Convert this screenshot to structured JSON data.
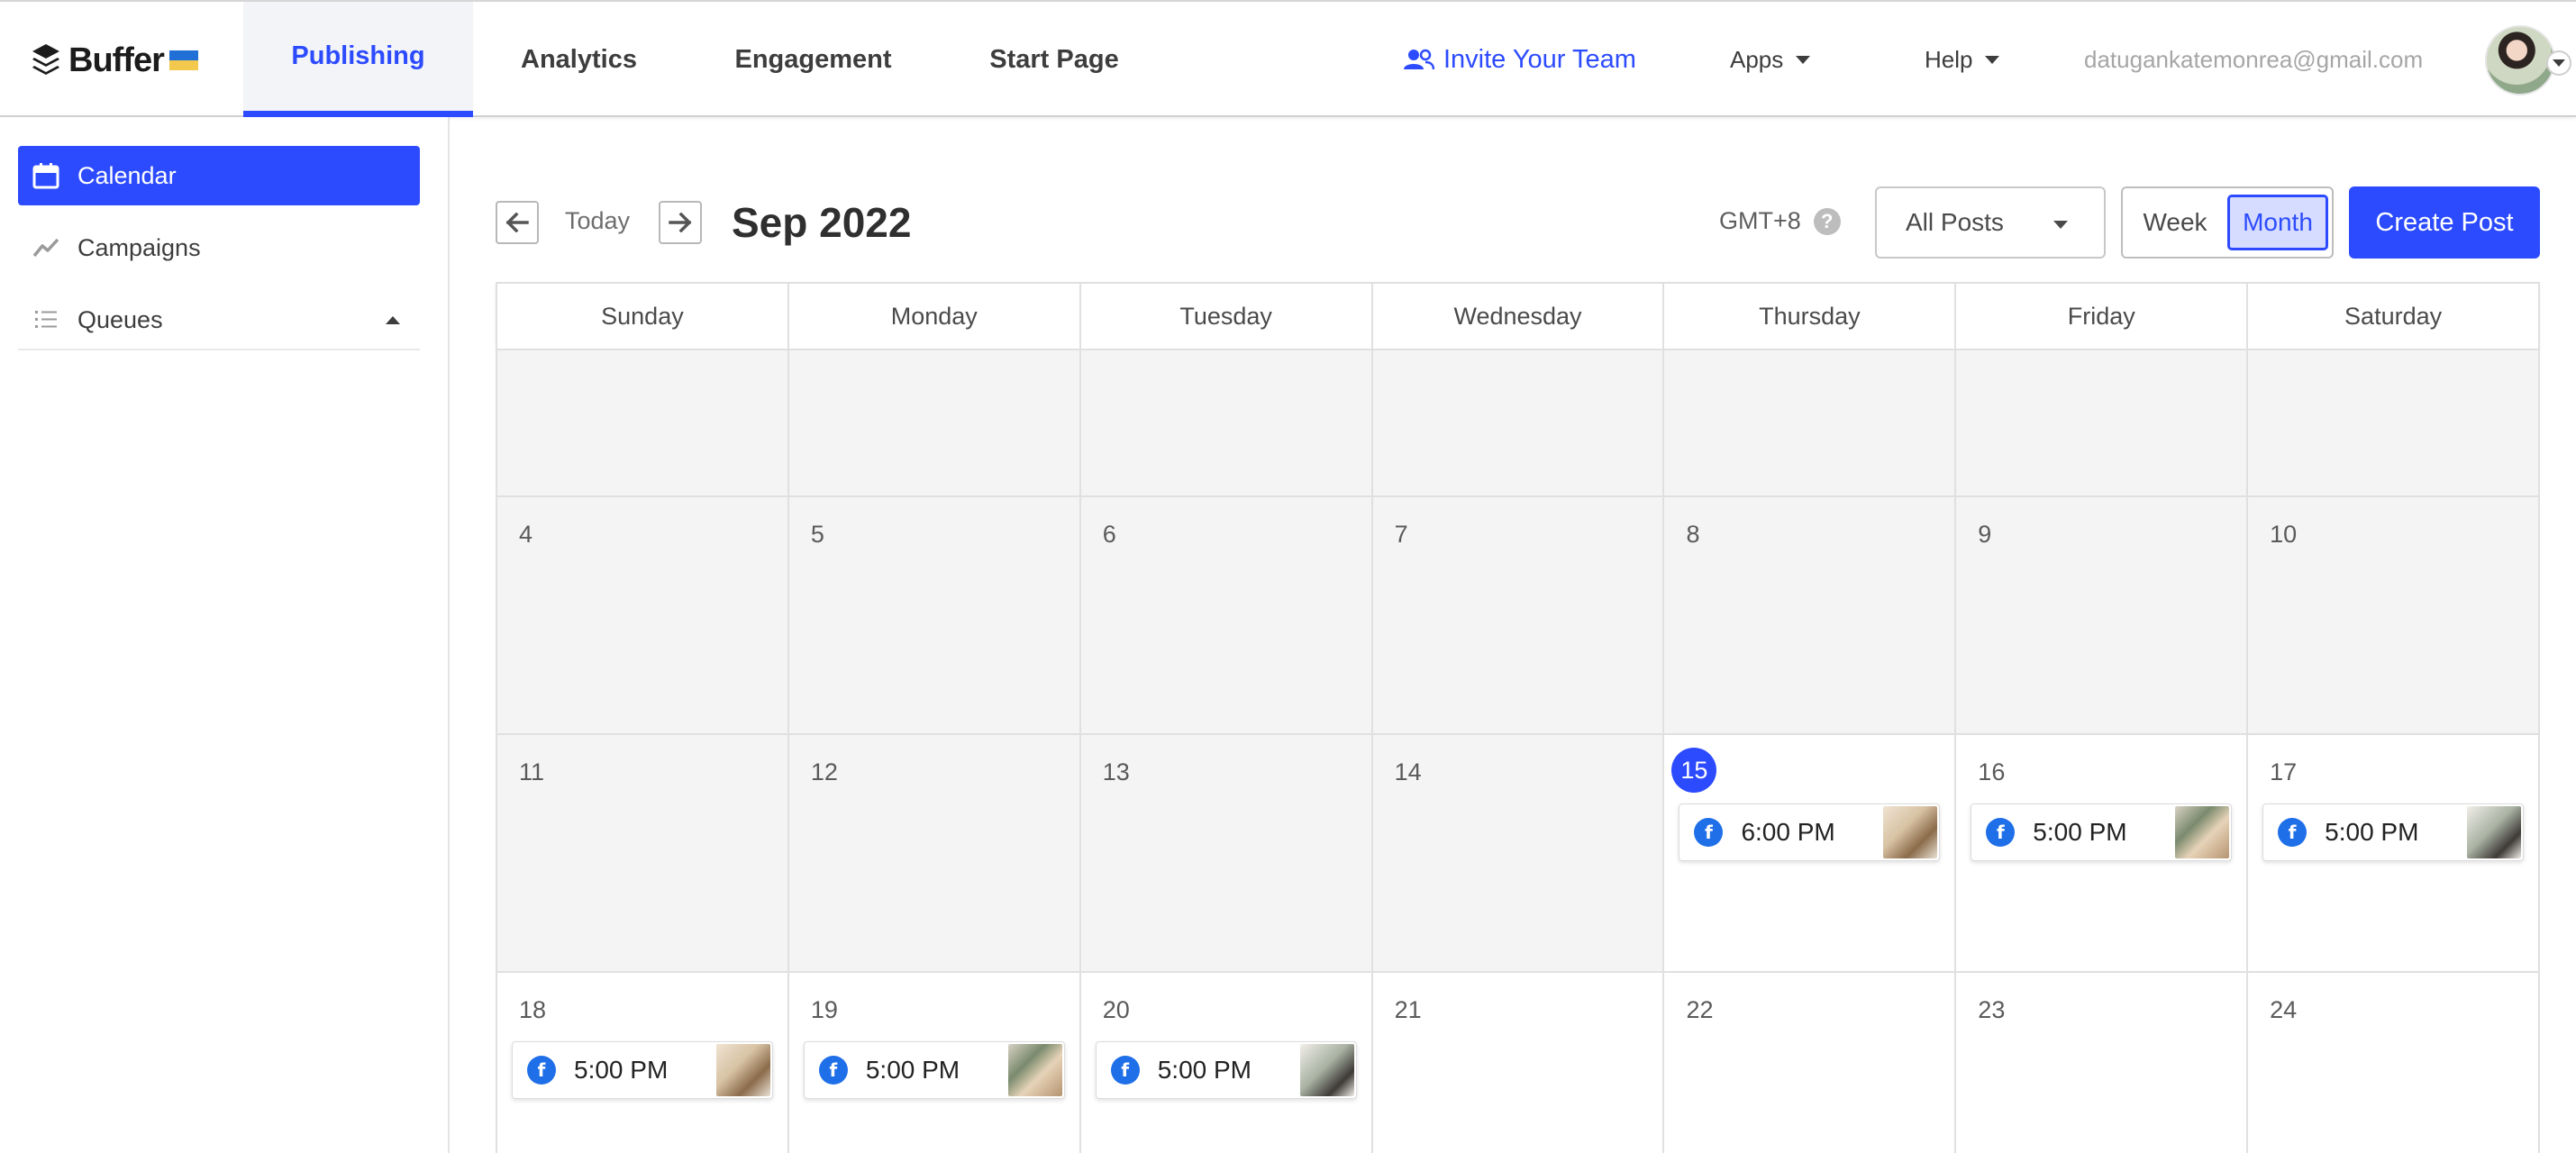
{
  "brand": {
    "name": "Buffer",
    "accent": "#2c4bff"
  },
  "nav": {
    "tabs": [
      {
        "label": "Publishing",
        "active": true
      },
      {
        "label": "Analytics",
        "active": false
      },
      {
        "label": "Engagement",
        "active": false
      },
      {
        "label": "Start Page",
        "active": false
      }
    ],
    "invite_label": "Invite Your Team",
    "apps_label": "Apps",
    "help_label": "Help",
    "user_email": "datugankatemonrea@gmail.com"
  },
  "sidebar": {
    "items": [
      {
        "label": "Calendar",
        "icon": "calendar-icon",
        "active": true
      },
      {
        "label": "Campaigns",
        "icon": "trend-icon",
        "active": false
      },
      {
        "label": "Queues",
        "icon": "list-icon",
        "active": false
      }
    ]
  },
  "toolbar": {
    "today_label": "Today",
    "month_title": "Sep 2022",
    "timezone": "GMT+8",
    "timezone_help": "?",
    "filter_value": "All Posts",
    "view_week": "Week",
    "view_month": "Month",
    "active_view": "Month",
    "create_label": "Create Post"
  },
  "calendar": {
    "day_headers": [
      "Sunday",
      "Monday",
      "Tuesday",
      "Wednesday",
      "Thursday",
      "Friday",
      "Saturday"
    ],
    "today": 15,
    "weeks": [
      [
        {
          "day": ""
        },
        {
          "day": ""
        },
        {
          "day": ""
        },
        {
          "day": ""
        },
        {
          "day": ""
        },
        {
          "day": ""
        },
        {
          "day": ""
        }
      ],
      [
        {
          "day": "4"
        },
        {
          "day": "5"
        },
        {
          "day": "6"
        },
        {
          "day": "7"
        },
        {
          "day": "8"
        },
        {
          "day": "9"
        },
        {
          "day": "10"
        }
      ],
      [
        {
          "day": "11"
        },
        {
          "day": "12"
        },
        {
          "day": "13"
        },
        {
          "day": "14"
        },
        {
          "day": "15",
          "post": {
            "time": "6:00 PM",
            "network": "facebook"
          }
        },
        {
          "day": "16",
          "post": {
            "time": "5:00 PM",
            "network": "facebook"
          }
        },
        {
          "day": "17",
          "post": {
            "time": "5:00 PM",
            "network": "facebook"
          }
        }
      ],
      [
        {
          "day": "18",
          "post": {
            "time": "5:00 PM",
            "network": "facebook"
          }
        },
        {
          "day": "19",
          "post": {
            "time": "5:00 PM",
            "network": "facebook"
          }
        },
        {
          "day": "20",
          "post": {
            "time": "5:00 PM",
            "network": "facebook"
          }
        },
        {
          "day": "21"
        },
        {
          "day": "22"
        },
        {
          "day": "23"
        },
        {
          "day": "24"
        }
      ]
    ]
  }
}
